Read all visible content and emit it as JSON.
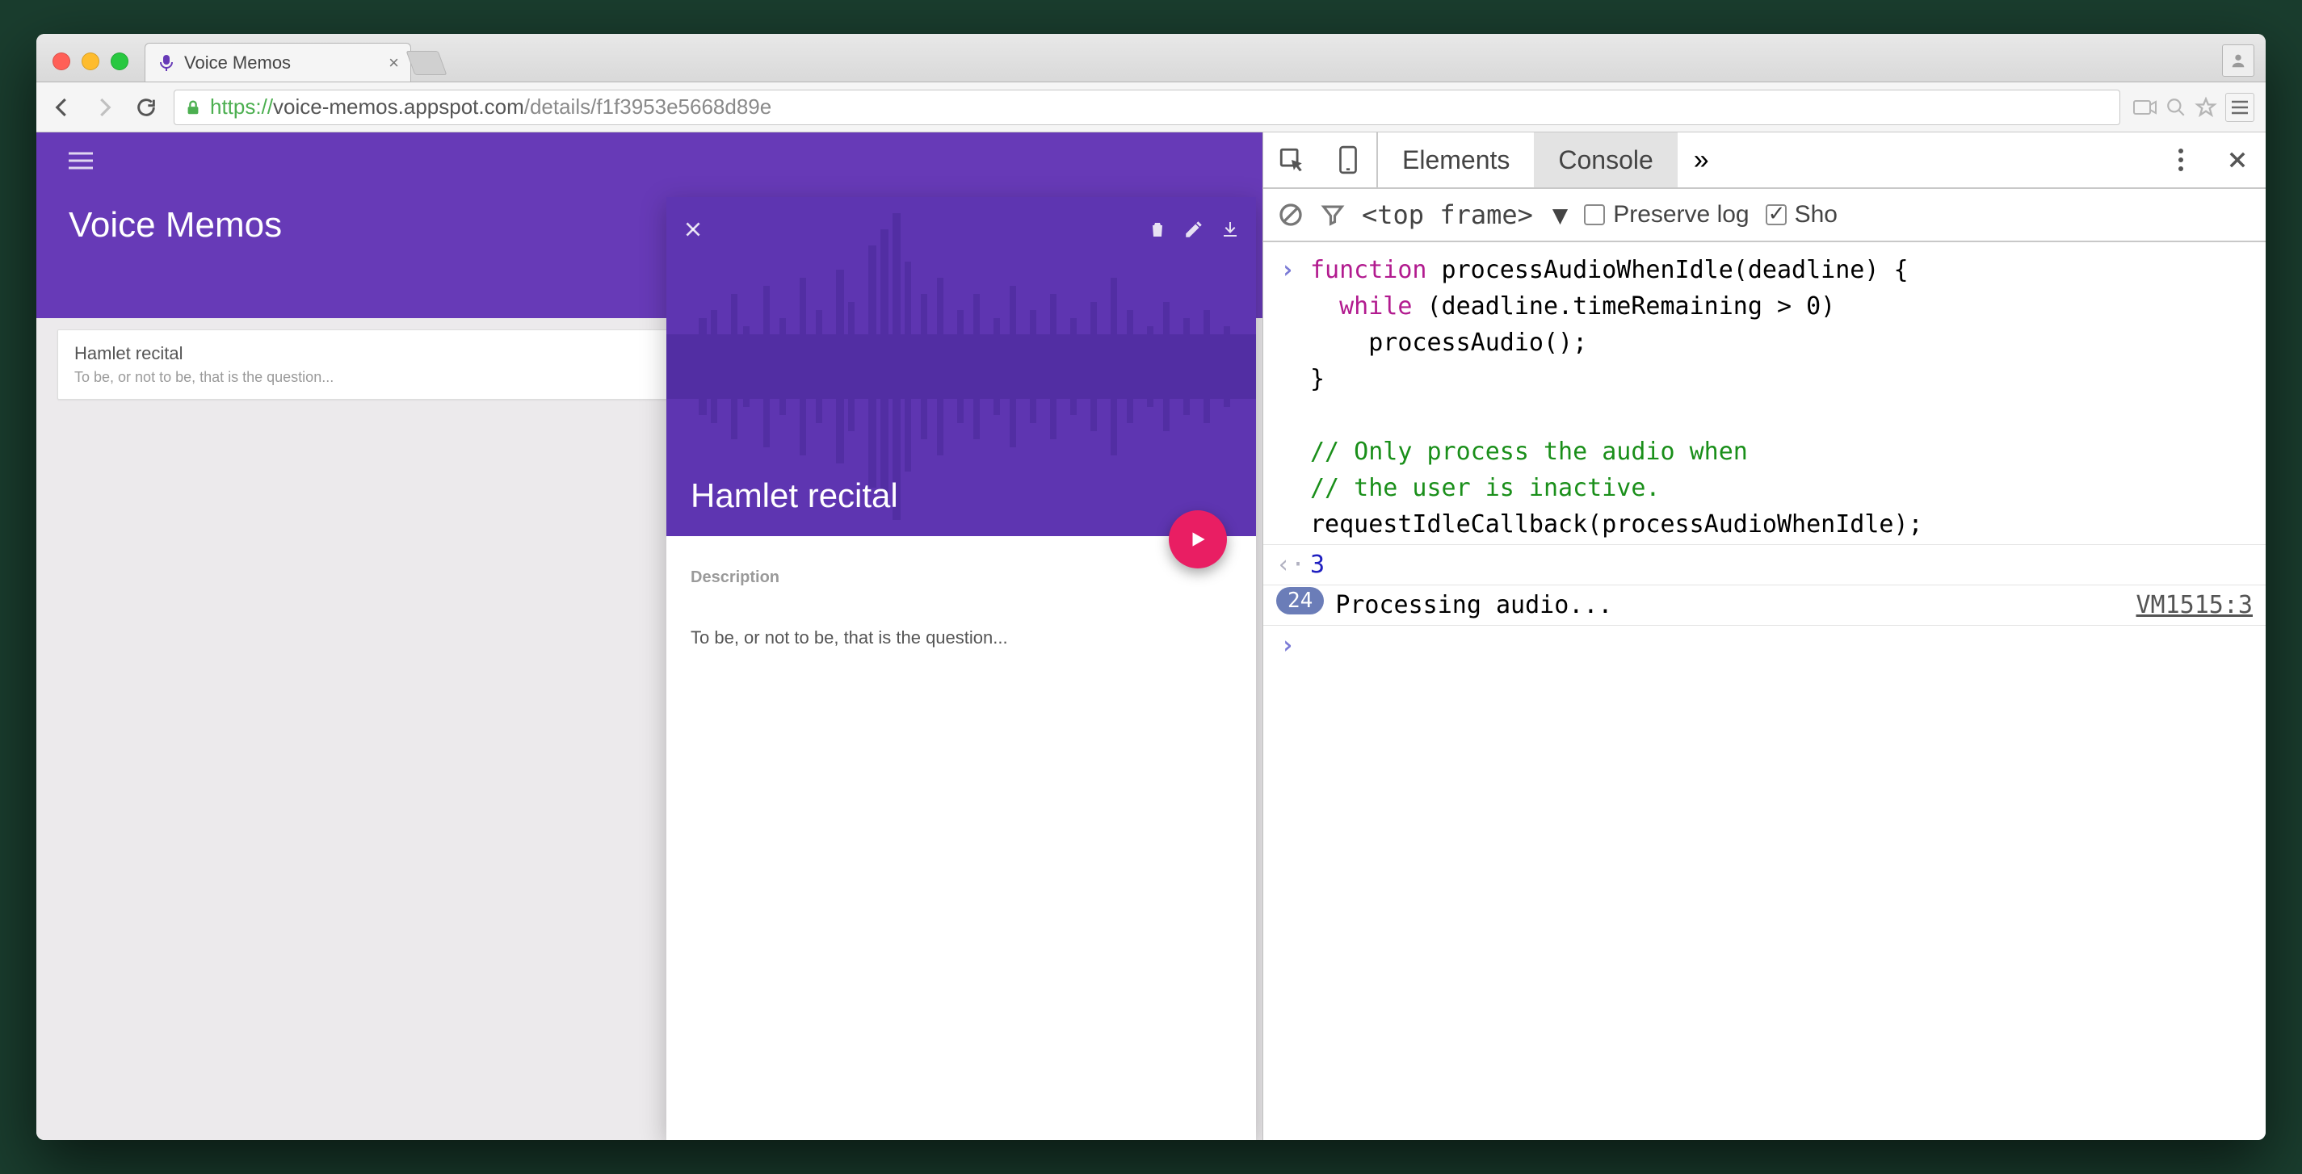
{
  "browser": {
    "tab_title": "Voice Memos",
    "url_scheme": "https://",
    "url_host": "voice-memos.appspot.com",
    "url_path": "/details/f1f3953e5668d89e"
  },
  "app": {
    "title": "Voice Memos",
    "list": [
      {
        "title": "Hamlet recital",
        "subtitle": "To be, or not to be, that is the question..."
      }
    ],
    "detail": {
      "title": "Hamlet recital",
      "description_label": "Description",
      "description": "To be, or not to be, that is the question..."
    }
  },
  "devtools": {
    "tabs": {
      "elements": "Elements",
      "console": "Console",
      "more": "»"
    },
    "subbar": {
      "frame": "<top frame>",
      "preserve_label": "Preserve log",
      "show_label": "Sho",
      "preserve_checked": false,
      "show_checked": true
    },
    "console": {
      "code_line1_kw": "function",
      "code_line1_rest": " processAudioWhenIdle(deadline) {",
      "code_line2_kw": "while",
      "code_line2_rest": " (deadline.timeRemaining > 0)",
      "code_line3": "    processAudio();",
      "code_line4": "}",
      "code_blank": "",
      "code_cmt1": "// Only process the audio when",
      "code_cmt2": "// the user is inactive.",
      "code_line5": "requestIdleCallback(processAudioWhenIdle);",
      "result": "3",
      "log_count": "24",
      "log_text": "Processing audio...",
      "log_source": "VM1515:3"
    }
  }
}
